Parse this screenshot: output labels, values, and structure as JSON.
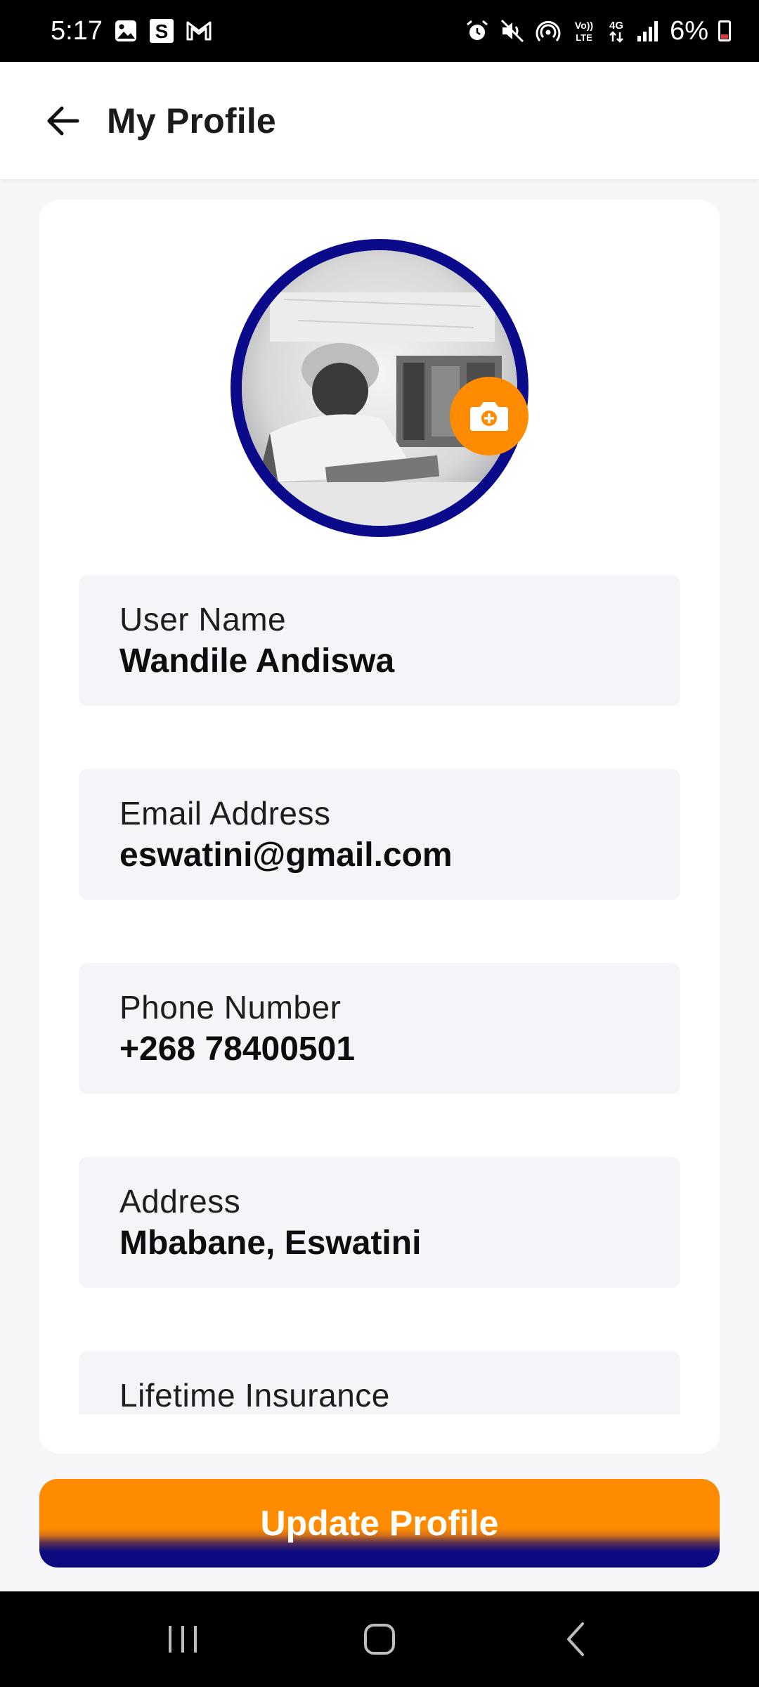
{
  "status_bar": {
    "time": "5:17",
    "battery_percent": "6%",
    "left_icons": [
      "gallery-icon",
      "s-app-icon",
      "gmail-icon"
    ],
    "right_icons": [
      "alarm-icon",
      "mute-icon",
      "hotspot-icon",
      "volte-icon",
      "4g-icon",
      "signal-icon",
      "battery-icon"
    ]
  },
  "app_bar": {
    "title": "My Profile",
    "back_icon": "arrow-back-icon"
  },
  "profile": {
    "avatar_icon": "profile-photo",
    "camera_icon": "camera-icon"
  },
  "fields": [
    {
      "label": "User Name",
      "value": "Wandile Andiswa"
    },
    {
      "label": "Email Address",
      "value": "eswatini@gmail.com"
    },
    {
      "label": "Phone Number",
      "value": "+268 78400501"
    },
    {
      "label": "Address",
      "value": "Mbabane, Eswatini"
    },
    {
      "label": "Lifetime Insurance",
      "value": ""
    }
  ],
  "actions": {
    "update_label": "Update Profile"
  },
  "nav_bar": {
    "icons": [
      "recent-apps-icon",
      "home-icon",
      "back-icon"
    ]
  },
  "colors": {
    "accent_orange": "#ff8c00",
    "accent_navy": "#0a0a8a",
    "field_bg": "#f4f4f9",
    "page_bg": "#f6f6f8"
  }
}
